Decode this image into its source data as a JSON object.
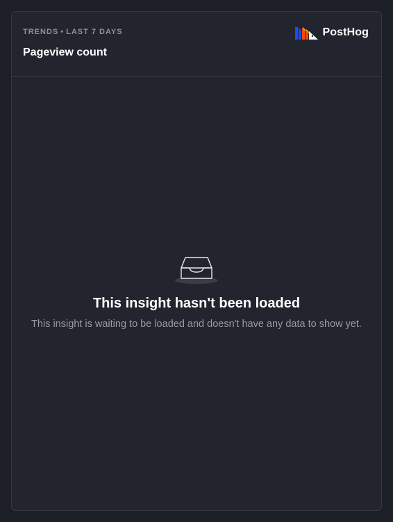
{
  "card": {
    "subtitle_kind": "Trends",
    "subtitle_separator": "•",
    "subtitle_range": "Last 7 days",
    "title": "Pageview count"
  },
  "brand": {
    "name": "PostHog",
    "logo_icon": "posthog-logo-icon"
  },
  "empty_state": {
    "icon": "inbox-icon",
    "title": "This insight hasn't been loaded",
    "description": "This insight is waiting to be loaded and doesn't have any data to show yet."
  },
  "colors": {
    "background": "#1d1f27",
    "card": "#23252e",
    "border": "#353742",
    "logo_blue": "#1d4aff",
    "logo_orange": "#f54e00",
    "logo_yellow": "#f9bd2b"
  }
}
